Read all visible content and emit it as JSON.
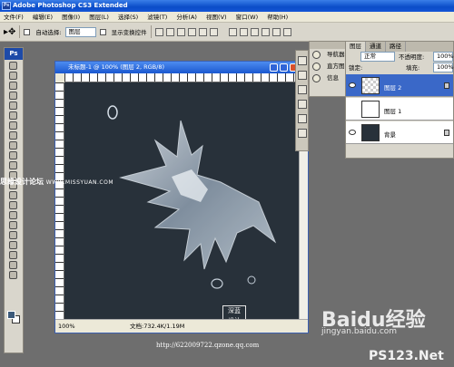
{
  "window": {
    "title": "Adobe Photoshop CS3 Extended"
  },
  "menu": [
    "文件(F)",
    "编辑(E)",
    "图像(I)",
    "图层(L)",
    "选择(S)",
    "滤镜(T)",
    "分析(A)",
    "视图(V)",
    "窗口(W)",
    "帮助(H)"
  ],
  "options": {
    "auto_select_label": "自动选择:",
    "auto_select_value": "图层",
    "show_transform_label": "显示变换控件"
  },
  "toolbox": {
    "logo": "Ps"
  },
  "document": {
    "title": "未标题-1 @ 100% (图层 2, RGB/8)",
    "zoom": "100%",
    "doc_info": "文档:732.4K/1.19M",
    "canvas_color": "#28313a"
  },
  "navigator": {
    "items": [
      "导航器",
      "直方图",
      "信息"
    ]
  },
  "layers": {
    "tabs": [
      "图层",
      "通道",
      "路径"
    ],
    "blend_mode": "正常",
    "opacity_label": "不透明度:",
    "opacity_value": "100%",
    "lock_label": "锁定:",
    "fill_label": "填充:",
    "fill_value": "100%",
    "items": [
      {
        "name": "图层 2",
        "active": true
      },
      {
        "name": "图层 1",
        "active": false
      },
      {
        "name": "背景",
        "active": false
      }
    ]
  },
  "watermarks": {
    "site_cn": "思缘设计论坛",
    "site_url": "WWW.MISSYUAN.COM",
    "seal_text": "深蓝\n设计",
    "blog_url": "http://622009722.qzone.qq.com",
    "baidu": "Baidu经验",
    "baidu_url": "jingyan.baidu.com",
    "ps123": "PS123.Net"
  }
}
